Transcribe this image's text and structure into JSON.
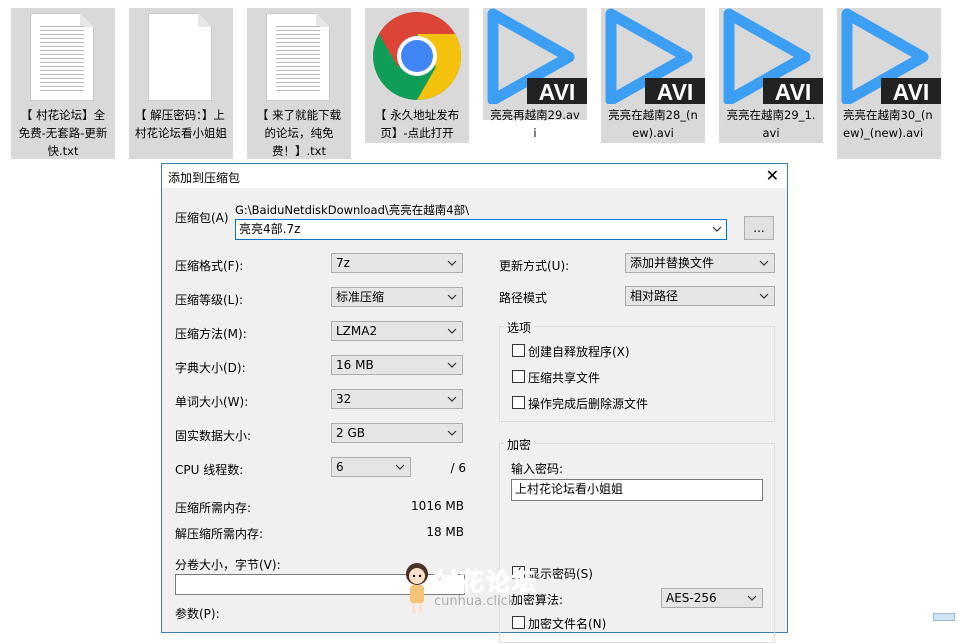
{
  "files": [
    {
      "name": "【 村花论坛】全免费-无套路-更新快.txt",
      "type": "text",
      "icon": "text-file-icon"
    },
    {
      "name": "【 解压密码：】上村花论坛看小姐姐",
      "type": "blank",
      "icon": "blank-file-icon"
    },
    {
      "name": "【 来了就能下载的论坛，纯免费！】.txt",
      "type": "text",
      "icon": "text-file-icon"
    },
    {
      "name": "【 永久地址发布页】-点此打开",
      "type": "chrome",
      "icon": "chrome-icon"
    },
    {
      "name": "亮亮再越南29.avi",
      "type": "avi",
      "icon": "avi-video-icon",
      "badge": "AVI"
    },
    {
      "name": "亮亮在越南28_(new).avi",
      "type": "avi",
      "icon": "avi-video-icon",
      "badge": "AVI"
    },
    {
      "name": "亮亮在越南29_1.avi",
      "type": "avi",
      "icon": "avi-video-icon",
      "badge": "AVI"
    },
    {
      "name": "亮亮在越南30_(new)_(new).avi",
      "type": "avi",
      "icon": "avi-video-icon",
      "badge": "AVI"
    }
  ],
  "dialog": {
    "title": "添加到压缩包",
    "archive_label": "压缩包(A)",
    "archive_path": "G:\\BaiduNetdiskDownload\\亮亮在越南4部\\",
    "archive_name": "亮亮4部.7z",
    "browse_label": "...",
    "format_label": "压缩格式(F):",
    "format_value": "7z",
    "level_label": "压缩等级(L):",
    "level_value": "标准压缩",
    "method_label": "压缩方法(M):",
    "method_value": "LZMA2",
    "dict_label": "字典大小(D):",
    "dict_value": "16 MB",
    "word_label": "单词大小(W):",
    "word_value": "32",
    "solid_label": "固实数据大小:",
    "solid_value": "2 GB",
    "cpu_label": "CPU 线程数:",
    "cpu_value": "6",
    "cpu_total": "/ 6",
    "mem_compress_label": "压缩所需内存:",
    "mem_compress_value": "1016 MB",
    "mem_decompress_label": "解压缩所需内存:",
    "mem_decompress_value": "18 MB",
    "split_label": "分卷大小，字节(V):",
    "split_value": "",
    "params_label": "参数(P):",
    "update_label": "更新方式(U):",
    "update_value": "添加并替换文件",
    "path_label": "路径模式",
    "path_value": "相对路径",
    "options_title": "选项",
    "opt_sfx": "创建自释放程序(X)",
    "opt_shared": "压缩共享文件",
    "opt_delete": "操作完成后删除源文件",
    "encrypt_title": "加密",
    "password_label": "输入密码:",
    "password_value": "上村花论坛看小姐姐",
    "show_password": "显示密码(S)",
    "enc_method_label": "加密算法:",
    "enc_method_value": "AES-256",
    "encrypt_names": "加密文件名(N)"
  },
  "watermark": {
    "text": "村花论坛",
    "sub": "cunhua.click"
  },
  "colors": {
    "accent": "#0078d7",
    "avi_blue": "#3d9ff3",
    "chrome_red": "#db4437",
    "chrome_yellow": "#f4c20d",
    "chrome_green": "#0f9d58",
    "watermark_pink": "#f06aa8"
  }
}
